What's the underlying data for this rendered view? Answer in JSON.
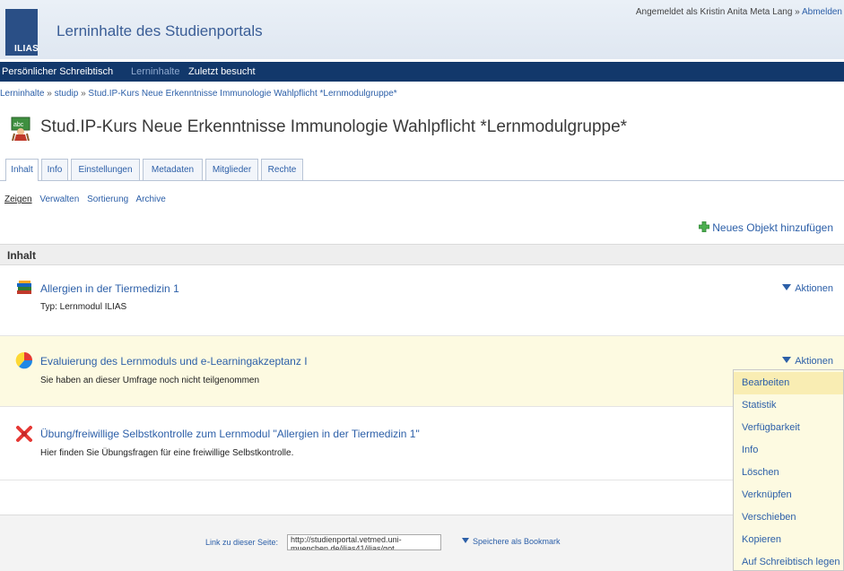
{
  "header": {
    "logo_text": "ILIAS",
    "site_title": "Lerninhalte des Studienportals",
    "user_prefix": "Angemeldet als Kristin Anita Meta Lang",
    "user_sep": "»",
    "logout": "Abmelden"
  },
  "mainmenu": {
    "items": [
      "Persönlicher Schreibtisch",
      "Lerninhalte",
      "Zuletzt besucht"
    ]
  },
  "breadcrumb": {
    "items": [
      "Lerninhalte",
      "studip",
      "Stud.IP-Kurs Neue Erkenntnisse Immunologie Wahlpflicht *Lernmodulgruppe*"
    ],
    "sep": "»"
  },
  "page": {
    "title": "Stud.IP-Kurs Neue Erkenntnisse Immunologie Wahlpflicht *Lernmodulgruppe*"
  },
  "tabs": [
    "Inhalt",
    "Info",
    "Einstellungen",
    "Metadaten",
    "Mitglieder",
    "Rechte"
  ],
  "subtabs": [
    "Zeigen",
    "Verwalten",
    "Sortierung",
    "Archive"
  ],
  "add_object": "Neues Objekt hinzufügen",
  "block": {
    "heading": "Inhalt",
    "items": [
      {
        "title": "Allergien in der Tiermedizin 1",
        "description": "Typ: Lernmodul ILIAS",
        "actions": "Aktionen",
        "icon": "learning-module-icon"
      },
      {
        "title": "Evaluierung des Lernmoduls und e-Learningakzeptanz I",
        "description": "Sie haben an dieser Umfrage noch nicht teilgenommen",
        "actions": "Aktionen",
        "icon": "survey-icon"
      },
      {
        "title": "Übung/freiwillige Selbstkontrolle zum Lernmodul \"Allergien in der Tiermedizin 1\"",
        "description": "Hier finden Sie Übungsfragen für eine freiwillige Selbstkontrolle.",
        "actions": "",
        "icon": "test-icon"
      }
    ]
  },
  "dropdown": {
    "items": [
      "Bearbeiten",
      "Statistik",
      "Verfügbarkeit",
      "Info",
      "Löschen",
      "Verknüpfen",
      "Verschieben",
      "Kopieren",
      "Auf Schreibtisch legen"
    ]
  },
  "footer": {
    "permalink_label": "Link zu dieser Seite:",
    "permalink_value": "http://studienportal.vetmed.uni-muenchen.de/ilias41/ilias/got",
    "bookmark": "Speichere als Bookmark"
  },
  "colors": {
    "menu_bar": "#12386b",
    "link": "#2c5fa8",
    "highlight_row": "#fdfae1",
    "dropdown_hover": "#f9edb3"
  }
}
